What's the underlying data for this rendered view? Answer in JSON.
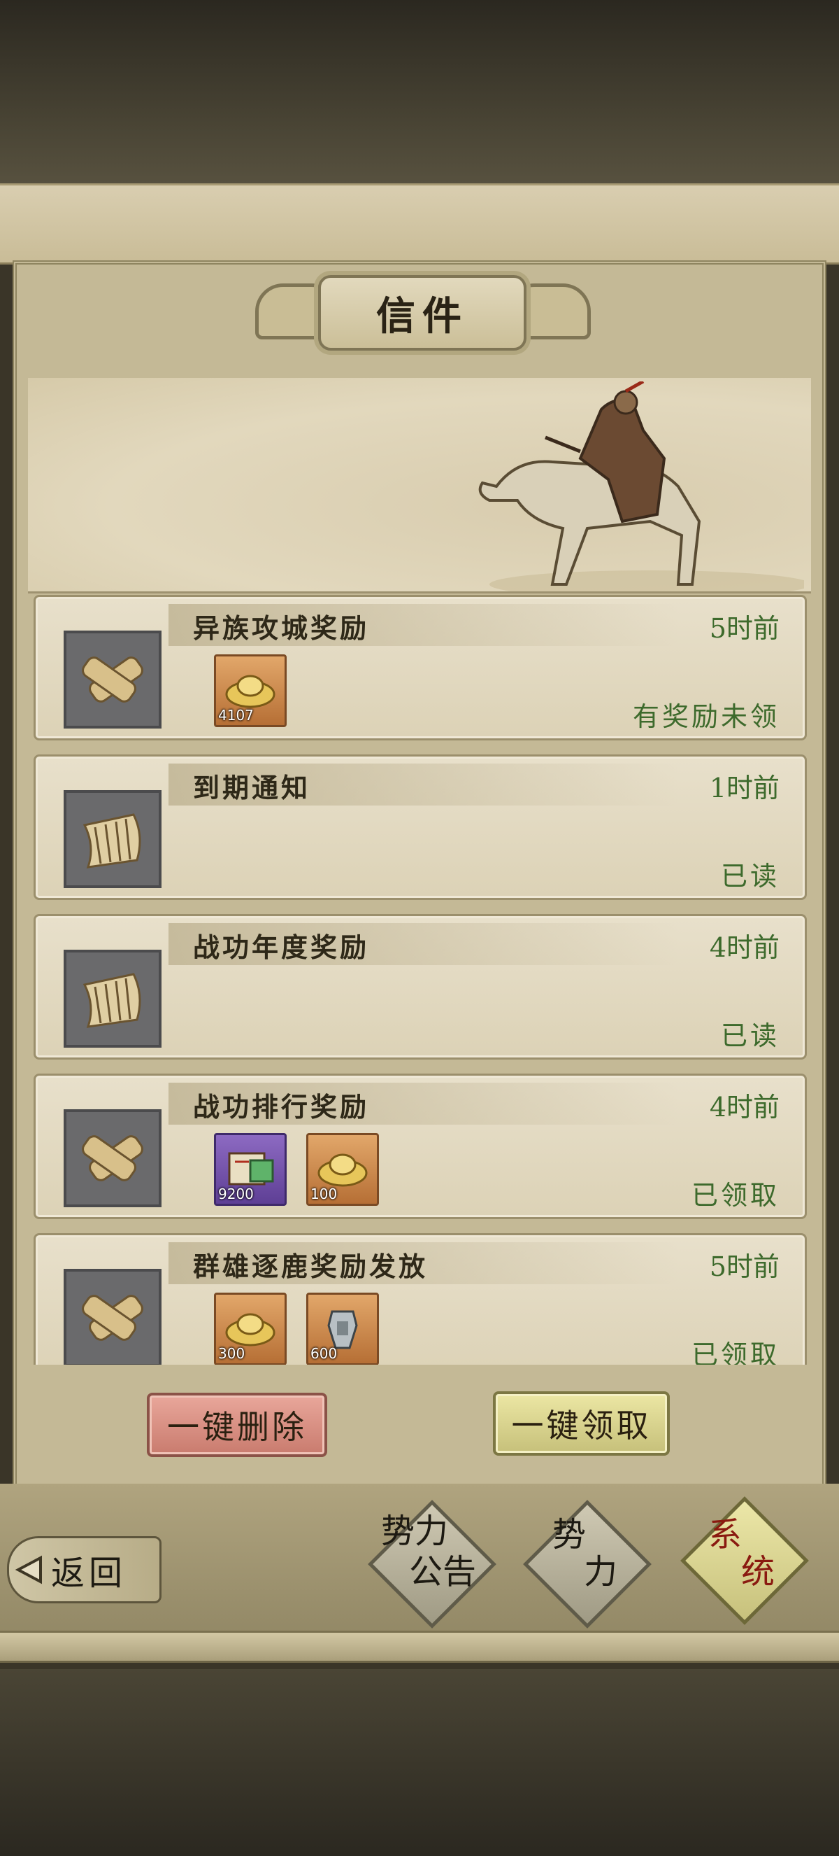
{
  "window": {
    "title": "信件"
  },
  "mails": [
    {
      "subject": "异族攻城奖励",
      "time": "5时前",
      "status": "有奖励未领",
      "icon": "bundle-icon",
      "rewards": [
        {
          "icon": "gold-ingot-icon",
          "qty": "4107",
          "color": "orange"
        }
      ]
    },
    {
      "subject": "到期通知",
      "time": "1时前",
      "status": "已读",
      "icon": "scroll-icon",
      "rewards": []
    },
    {
      "subject": "战功年度奖励",
      "time": "4时前",
      "status": "已读",
      "icon": "scroll-icon",
      "rewards": []
    },
    {
      "subject": "战功排行奖励",
      "time": "4时前",
      "status": "已领取",
      "icon": "bundle-icon",
      "rewards": [
        {
          "icon": "book-icon",
          "qty": "9200",
          "color": "purple"
        },
        {
          "icon": "gold-ingot-icon",
          "qty": "100",
          "color": "orange"
        }
      ]
    },
    {
      "subject": "群雄逐鹿奖励发放",
      "time": "5时前",
      "status": "已领取",
      "icon": "bundle-icon",
      "rewards": [
        {
          "icon": "gold-ingot-icon",
          "qty": "300",
          "color": "orange"
        },
        {
          "icon": "token-icon",
          "qty": "600",
          "color": "orange"
        }
      ]
    }
  ],
  "actions": {
    "delete_all": "一键删除",
    "claim_all": "一键领取"
  },
  "nav": {
    "back": "返回",
    "tabs": [
      {
        "line1": "势力",
        "line2": "公告",
        "active": false
      },
      {
        "line1": "势",
        "line2": "力",
        "active": false
      },
      {
        "line1": "系",
        "line2": "统",
        "active": true
      }
    ]
  },
  "colors": {
    "time_green": "#3d6a2c",
    "active_tab_text": "#8a1a10"
  }
}
